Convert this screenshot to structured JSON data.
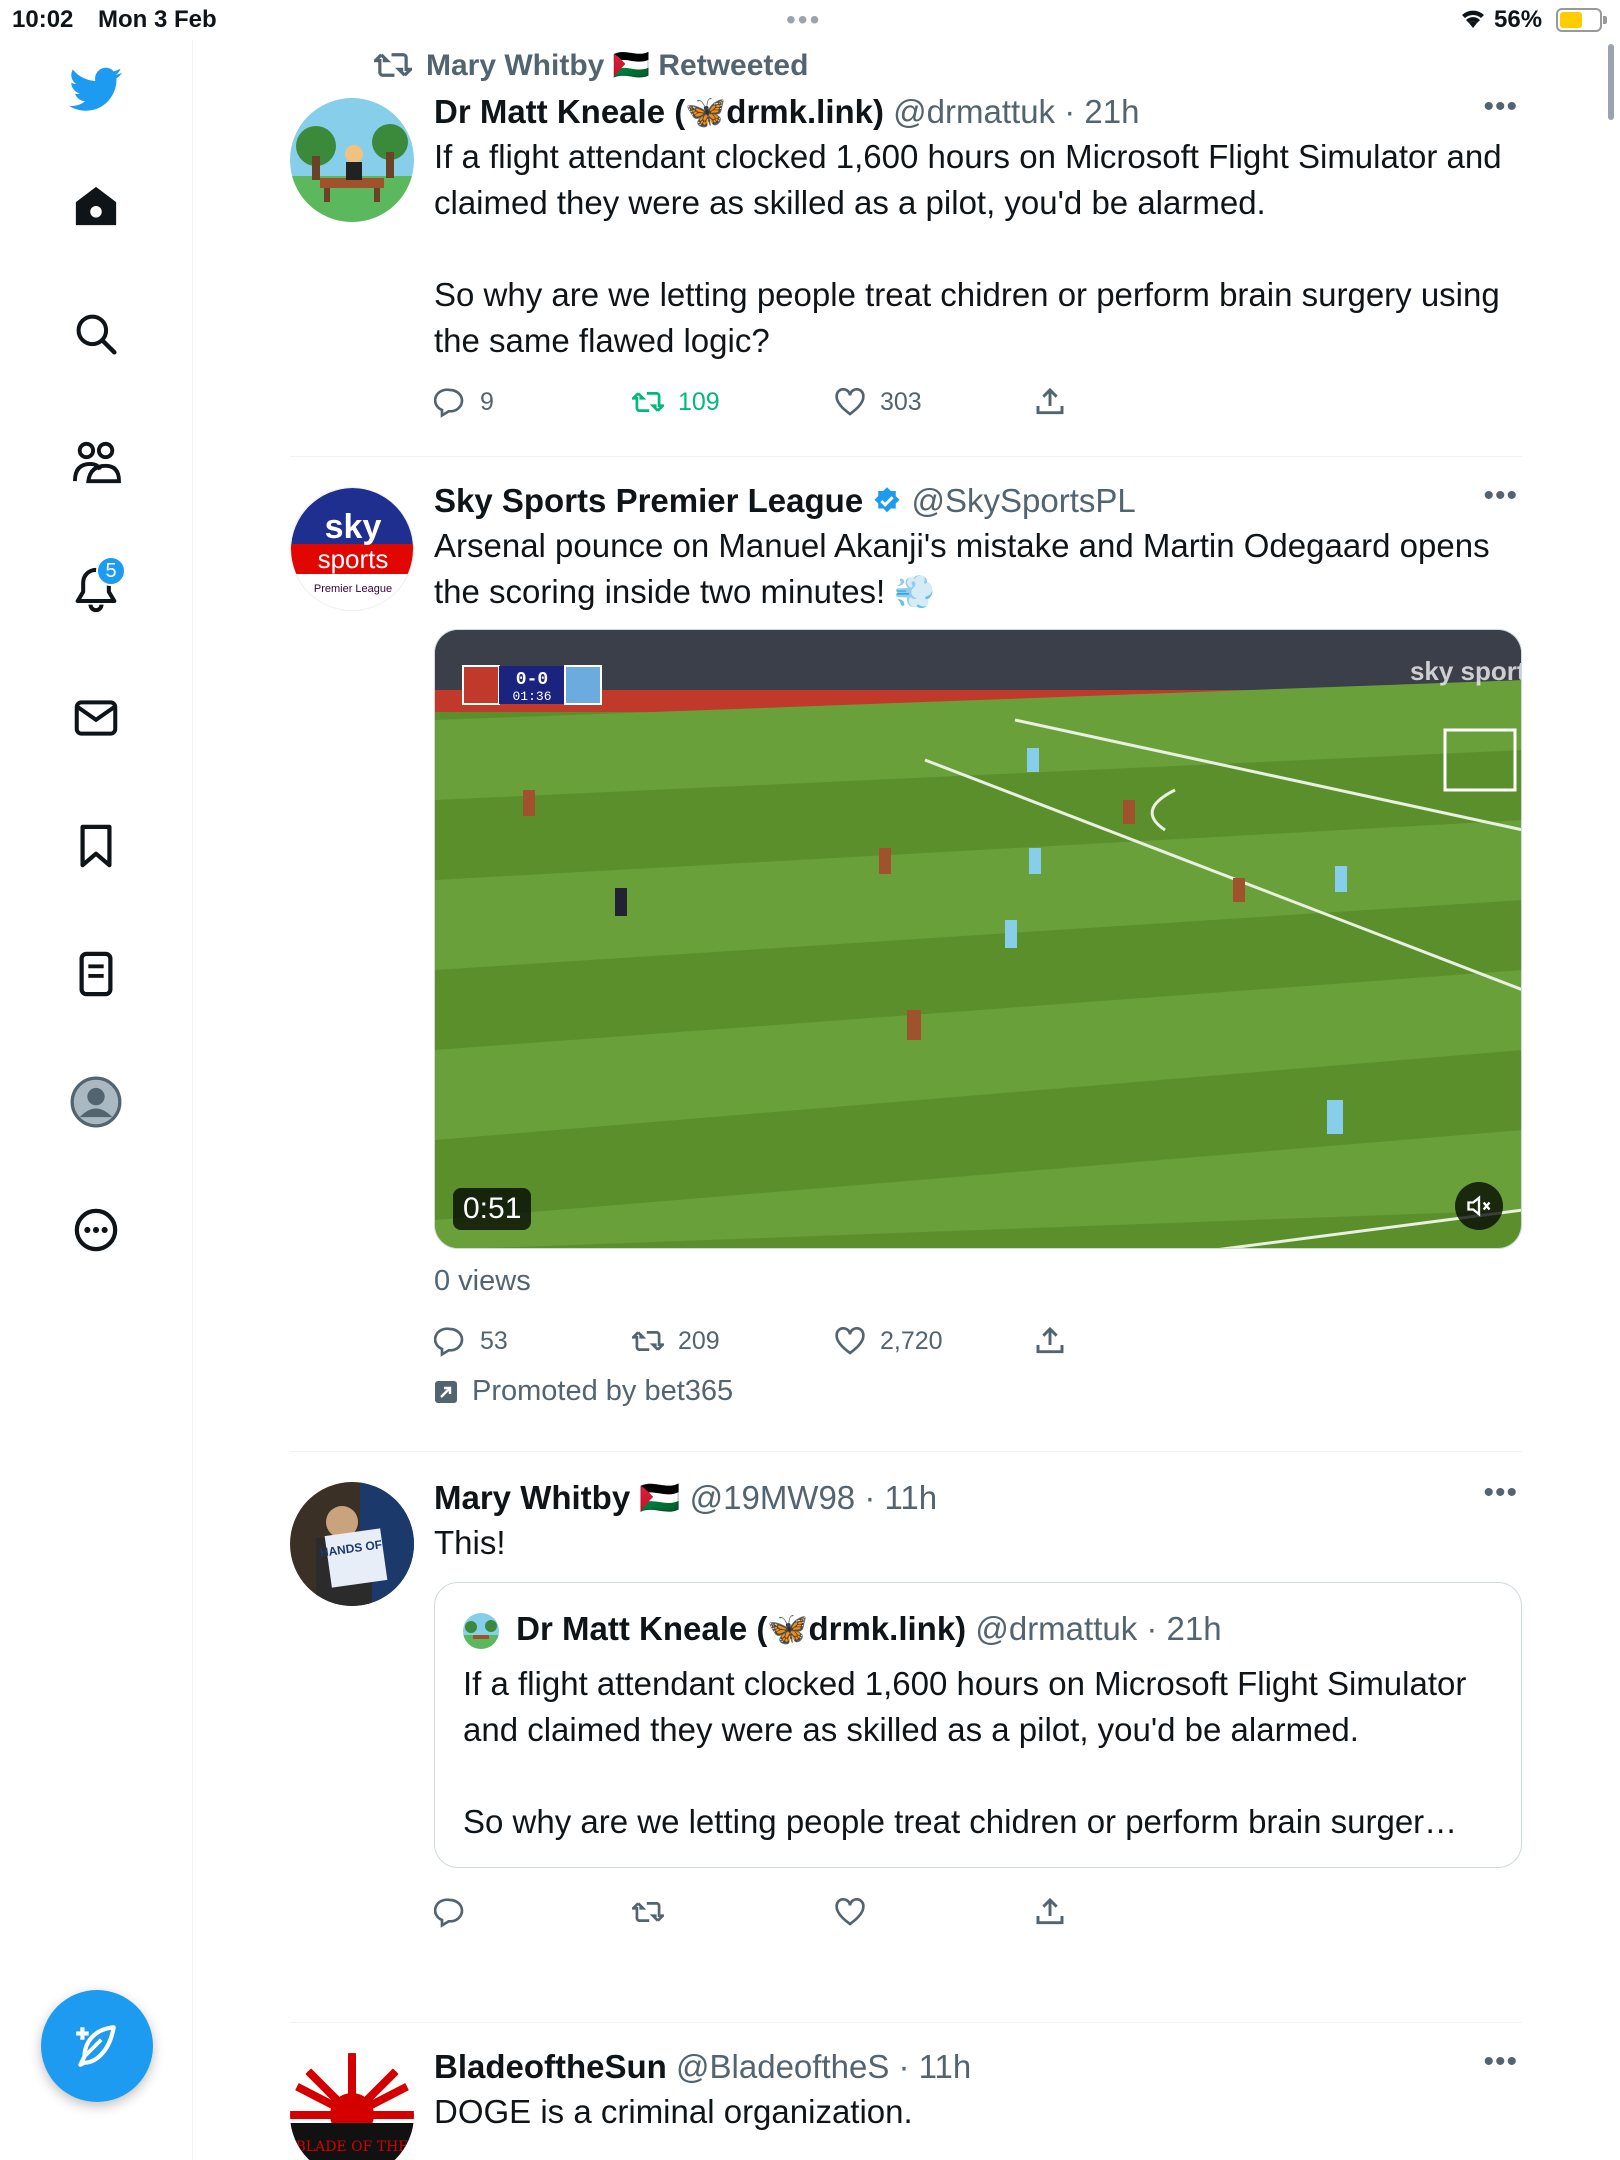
{
  "status_bar": {
    "time": "10:02",
    "date": "Mon 3 Feb",
    "battery_pct": "56%"
  },
  "sidebar": {
    "notifications_badge": "5",
    "brand_color": "#1d9bf0"
  },
  "feed": {
    "tweet1": {
      "retweeted_by": "Mary Whitby 🇵🇸 Retweeted",
      "name": "Dr Matt Kneale (🦋drmk.link)",
      "handle": "@drmattuk · 21h",
      "text_1": "If a flight attendant clocked 1,600 hours on Microsoft Flight Simulator and claimed they were as skilled as a pilot, you'd be alarmed.",
      "text_2": "So why are we letting people treat chidren or perform brain surgery using the same flawed logic?",
      "replies": "9",
      "retweets": "109",
      "likes": "303"
    },
    "tweet2": {
      "name": "Sky Sports Premier League",
      "handle": "@SkySportsPL",
      "text": "Arsenal pounce on Manuel Akanji's mistake and Martin Odegaard opens the scoring inside two minutes! 💨",
      "avatar_sky": "sky",
      "avatar_sports": "sports",
      "avatar_league": "Premier League",
      "video_score": "0-0",
      "video_clock": "01:36",
      "video_duration": "0:51",
      "video_watermark": "sky sports",
      "views": "0 views",
      "replies": "53",
      "retweets": "209",
      "likes": "2,720",
      "promoted": "Promoted by bet365"
    },
    "tweet3": {
      "name": "Mary Whitby 🇵🇸",
      "handle": "@19MW98 · 11h",
      "text": "This!",
      "avatar_sign": "HANDS OFF",
      "quote": {
        "name": "Dr Matt Kneale (🦋drmk.link)",
        "handle": "@drmattuk · 21h",
        "text_1": "If a flight attendant clocked 1,600 hours on Microsoft Flight Simulator and claimed they were as skilled as a pilot, you'd be alarmed.",
        "text_2": "So why are we letting people treat chidren or perform brain surger…"
      }
    },
    "tweet4": {
      "name": "BladeoftheSun",
      "handle": "@BladeoftheS · 11h",
      "text": "DOGE is a criminal organization.",
      "avatar_text": "BLADE OF THE"
    }
  }
}
